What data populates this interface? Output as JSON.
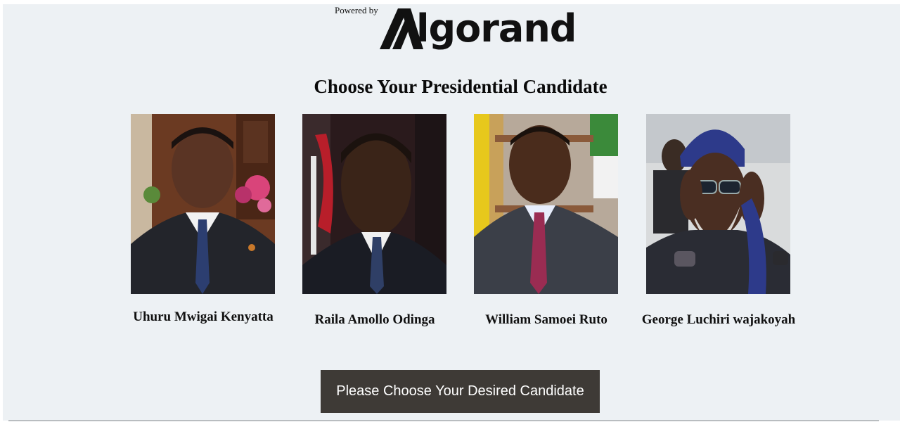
{
  "header": {
    "powered_by": "Powered by",
    "brand": "lgorand",
    "brand_full": "Algorand"
  },
  "page": {
    "title": "Choose Your Presidential Candidate"
  },
  "candidates": [
    {
      "name": "Uhuru Mwigai Kenyatta"
    },
    {
      "name": "Raila Amollo Odinga"
    },
    {
      "name": "William Samoei Ruto"
    },
    {
      "name": "George Luchiri wajakoyah"
    }
  ],
  "action": {
    "choose_label": "Please Choose Your Desired Candidate"
  },
  "colors": {
    "background": "#edf1f4",
    "button": "#3e3a36",
    "button_text": "#ffffff"
  },
  "icons": {
    "brand_logo": "algorand-logo-icon"
  }
}
